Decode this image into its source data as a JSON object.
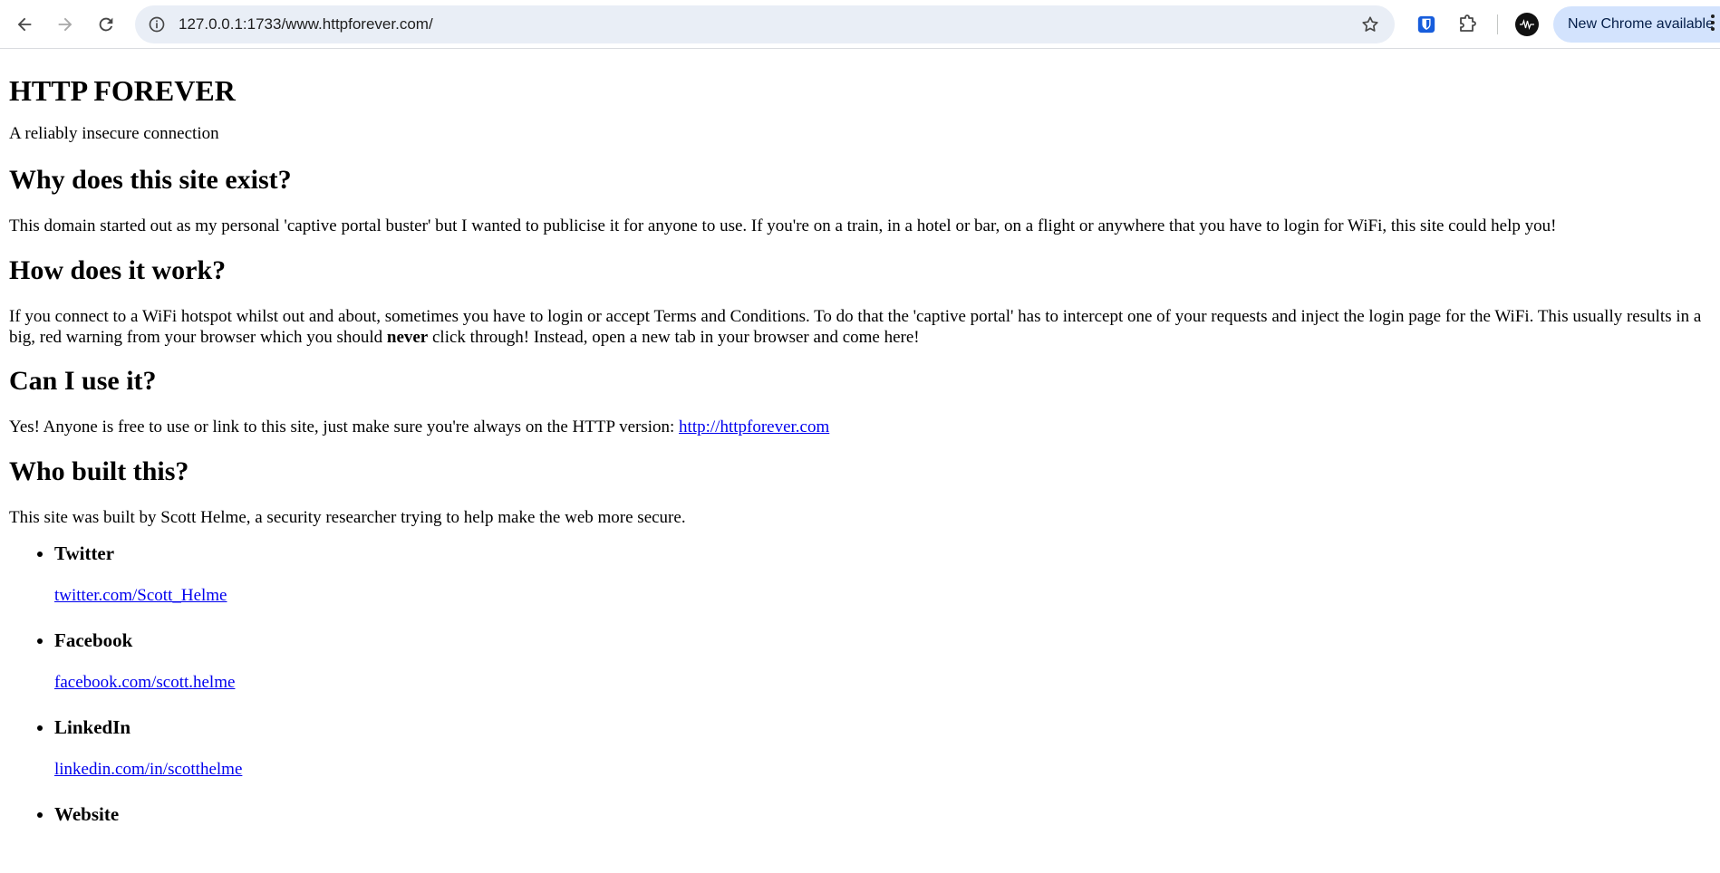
{
  "browser": {
    "url": "127.0.0.1:1733/www.httpforever.com/",
    "update_label": "New Chrome available"
  },
  "page": {
    "title": "HTTP FOREVER",
    "subtitle": "A reliably insecure connection",
    "sections": {
      "why": {
        "heading": "Why does this site exist?",
        "text": "This domain started out as my personal 'captive portal buster' but I wanted to publicise it for anyone to use. If you're on a train, in a hotel or bar, on a flight or anywhere that you have to login for WiFi, this site could help you!"
      },
      "how": {
        "heading": "How does it work?",
        "text_before": "If you connect to a WiFi hotspot whilst out and about, sometimes you have to login or accept Terms and Conditions. To do that the 'captive portal' has to intercept one of your requests and inject the login page for the WiFi. This usually results in a big, red warning from your browser which you should ",
        "text_bold": "never",
        "text_after": " click through! Instead, open a new tab in your browser and come here!"
      },
      "can": {
        "heading": "Can I use it?",
        "text": "Yes! Anyone is free to use or link to this site, just make sure you're always on the HTTP version: ",
        "link": "http://httpforever.com"
      },
      "who": {
        "heading": "Who built this?",
        "text": "This site was built by Scott Helme, a security researcher trying to help make the web more secure."
      }
    },
    "social": [
      {
        "label": "Twitter",
        "link": "twitter.com/Scott_Helme"
      },
      {
        "label": "Facebook",
        "link": "facebook.com/scott.helme"
      },
      {
        "label": "LinkedIn",
        "link": "linkedin.com/in/scotthelme"
      },
      {
        "label": "Website",
        "link": ""
      }
    ]
  }
}
